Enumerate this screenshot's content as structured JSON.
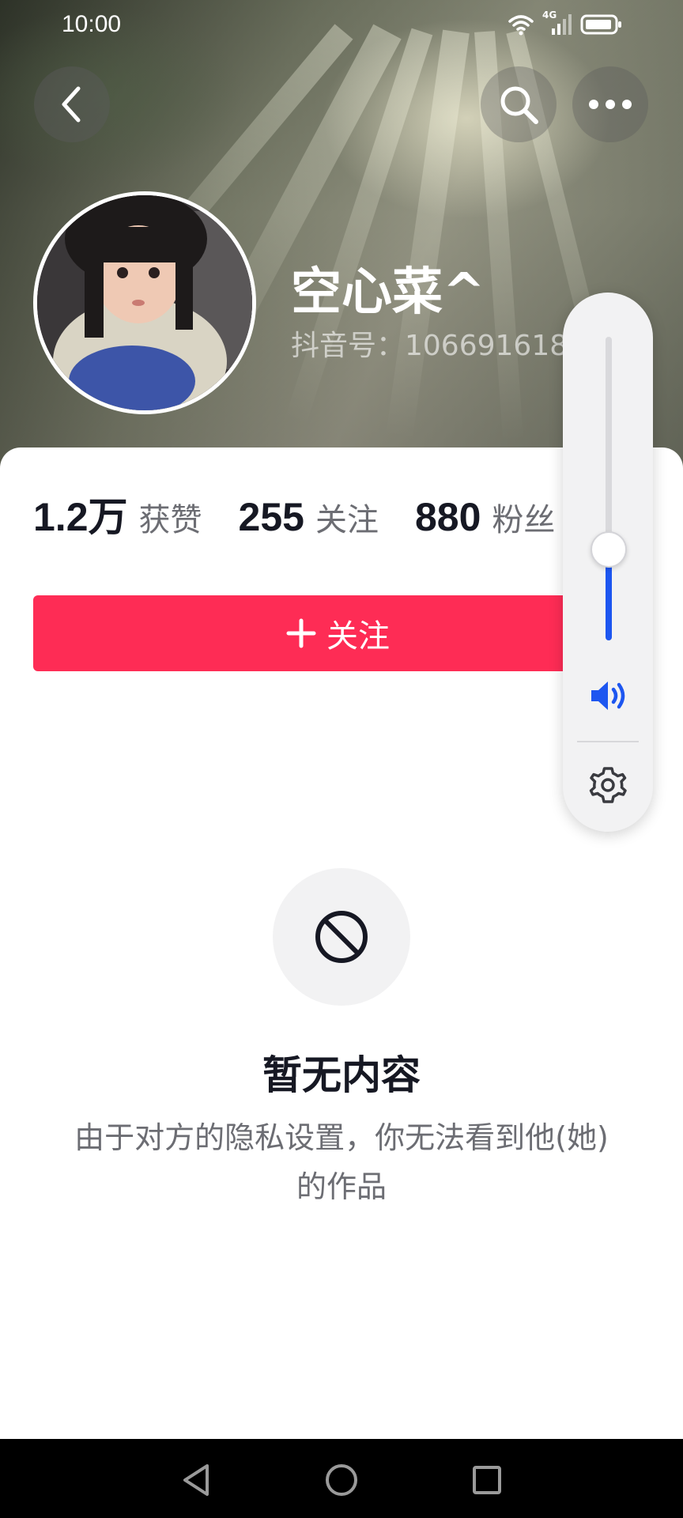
{
  "status_bar": {
    "time": "10:00",
    "network_label": "4G"
  },
  "header": {
    "back_icon": "chevron-left-icon",
    "search_icon": "search-icon",
    "more_icon": "more-dots-icon"
  },
  "profile": {
    "nickname": "空心菜^",
    "douyin_id": "抖音号：106691618"
  },
  "stats": [
    {
      "value": "1.2万",
      "label": "获赞"
    },
    {
      "value": "255",
      "label": "关注"
    },
    {
      "value": "880",
      "label": "粉丝"
    }
  ],
  "follow_button": {
    "plus": "+",
    "label": "关注"
  },
  "empty_state": {
    "title": "暂无内容",
    "description": "由于对方的隐私设置，你无法看到他(她)的作品"
  },
  "volume_panel": {
    "level": 0.3,
    "speaker_icon": "speaker-icon",
    "settings_icon": "gear-icon"
  },
  "colors": {
    "follow_red": "#fe2c55",
    "volume_blue": "#1d56f0",
    "primary_text": "#161823",
    "secondary_text": "#6c6d73"
  }
}
